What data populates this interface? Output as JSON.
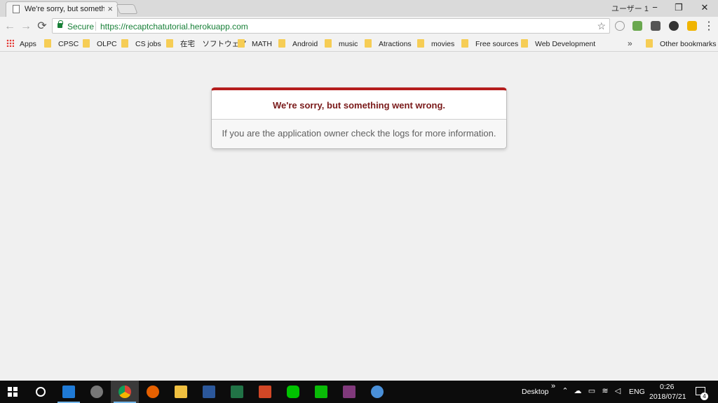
{
  "tab": {
    "title": "We're sorry, but something went wrong"
  },
  "window": {
    "profile": "ユーザー 1",
    "minimize": "−",
    "restore": "❐",
    "close": "✕"
  },
  "toolbar": {
    "back": "←",
    "forward": "→",
    "reload": "⟳",
    "secure_label": "Secure",
    "url": "https://recaptchatutorial.herokuapp.com",
    "star": "☆",
    "menu": "⋮"
  },
  "bookmarks": {
    "apps": "Apps",
    "items": [
      "CPSC",
      "OLPC",
      "CS jobs",
      "在宅　ソフトウェア",
      "MATH",
      "Android",
      "music",
      "Atractions",
      "movies",
      "Free sources",
      "Web Development"
    ],
    "overflow": "»",
    "other": "Other bookmarks"
  },
  "error": {
    "heading": "We're sorry, but something went wrong.",
    "message": "If you are the application owner check the logs for more information."
  },
  "taskbar": {
    "desktop_label": "Desktop",
    "overflow": "»",
    "language": "ENG",
    "time": "0:26",
    "date": "2018/07/21",
    "notification_count": "4"
  },
  "colors": {
    "accent_red": "#b51d1d",
    "heading_red": "#7a1a1a",
    "secure_green": "#188038"
  }
}
